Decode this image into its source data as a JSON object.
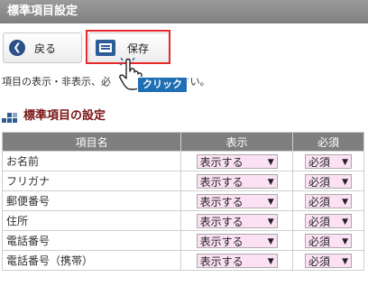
{
  "header": {
    "title": "標準項目設定"
  },
  "toolbar": {
    "back_label": "戻る",
    "save_label": "保存"
  },
  "instruction": {
    "prefix": "項目の表示・非表示、必",
    "suffix": "てください。"
  },
  "annotation": {
    "click_label": "クリック"
  },
  "section": {
    "title": "標準項目の設定"
  },
  "table": {
    "columns": [
      "項目名",
      "表示",
      "必須"
    ],
    "rows": [
      {
        "name": "お名前",
        "display": "表示する",
        "required": "必須"
      },
      {
        "name": "フリガナ",
        "display": "表示する",
        "required": "必須"
      },
      {
        "name": "郵便番号",
        "display": "表示する",
        "required": "必須"
      },
      {
        "name": "住所",
        "display": "表示する",
        "required": "必須"
      },
      {
        "name": "電話番号",
        "display": "表示する",
        "required": "必須"
      },
      {
        "name": "電話番号（携帯）",
        "display": "表示する",
        "required": "必須"
      }
    ]
  },
  "colors": {
    "header_bg": "#7f7f7f",
    "select_bg": "#fbe1f3",
    "highlight": "#e8272b",
    "section_title": "#7a1414",
    "click_badge": "#1f6fb5"
  },
  "icons": {
    "back": "back-arrow-icon",
    "save": "save-icon",
    "pointer": "hand-pointer-icon",
    "section": "grid-squares-icon",
    "dropdown": "dropdown-arrow-icon"
  }
}
